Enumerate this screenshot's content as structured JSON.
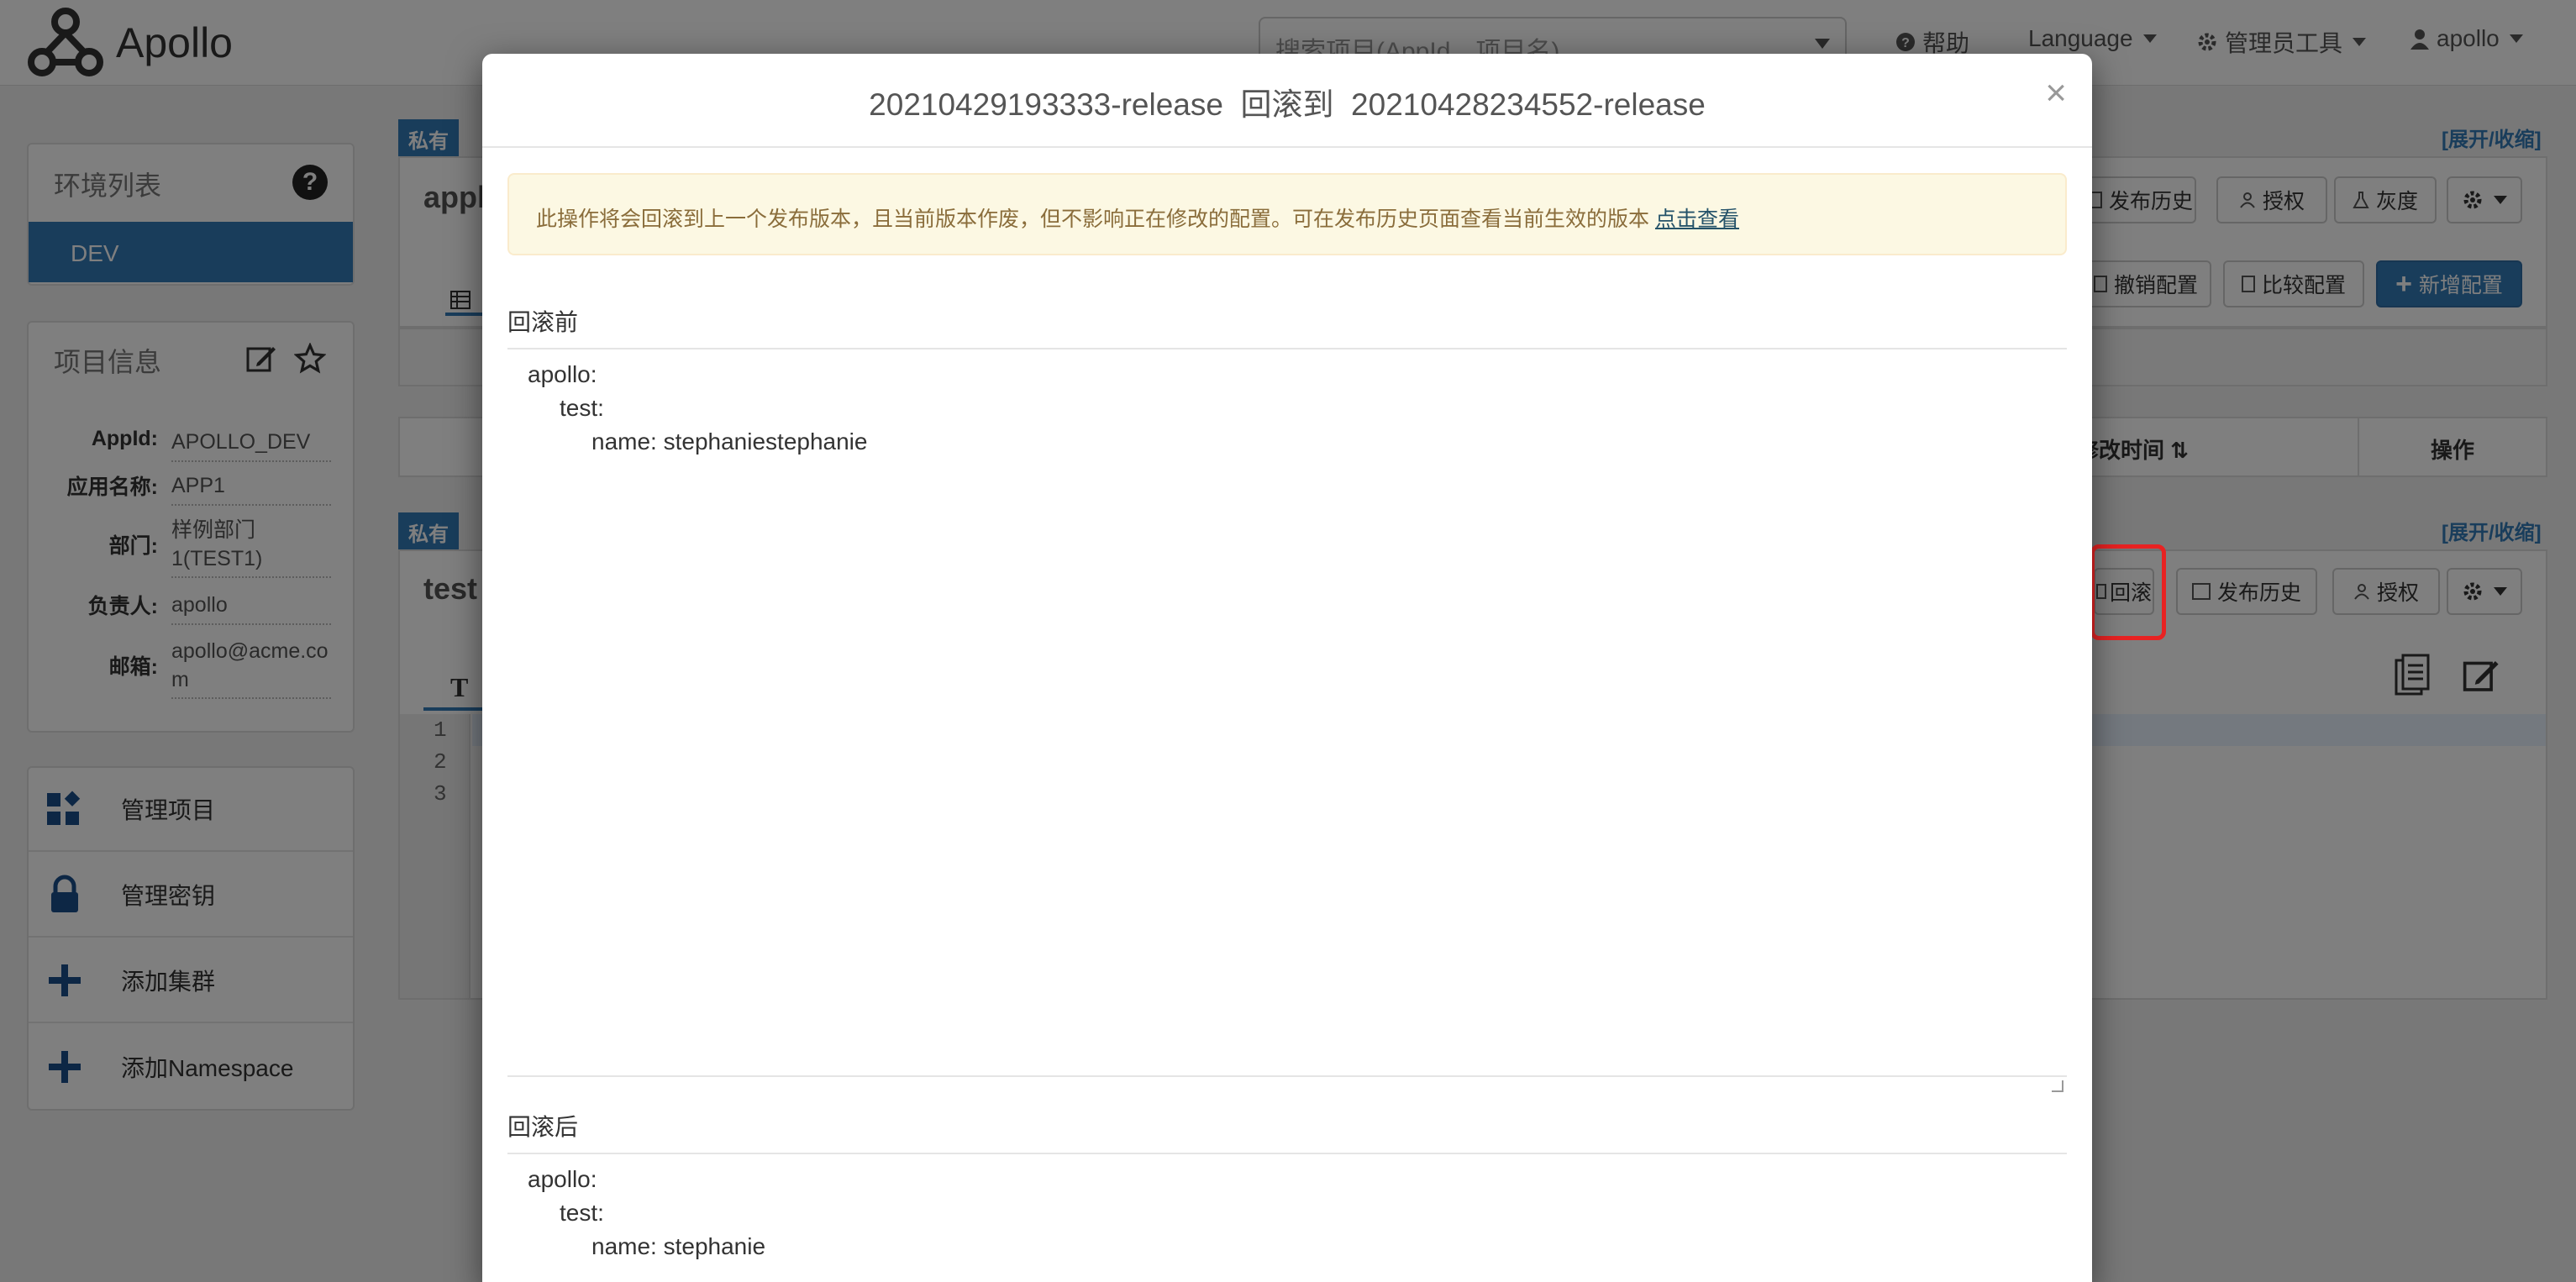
{
  "navbar": {
    "brand": "Apollo",
    "search_placeholder": "搜索项目(AppId、项目名)",
    "help": "帮助",
    "language": "Language",
    "admin_tools": "管理员工具",
    "user": "apollo"
  },
  "sidebar": {
    "env_title": "环境列表",
    "env_active": "DEV",
    "info_title": "项目信息",
    "info": [
      {
        "label": "AppId:",
        "value": "APOLLO_DEV"
      },
      {
        "label": "应用名称:",
        "value": "APP1"
      },
      {
        "label": "部门:",
        "value": "样例部门1(TEST1)"
      },
      {
        "label": "负责人:",
        "value": "apollo"
      },
      {
        "label": "邮箱:",
        "value": "apollo@acme.com"
      }
    ],
    "menu": [
      {
        "label": "管理项目",
        "icon": "grid-icon"
      },
      {
        "label": "管理密钥",
        "icon": "lock-icon"
      },
      {
        "label": "添加集群",
        "icon": "plus-icon"
      },
      {
        "label": "添加Namespace",
        "icon": "plus-icon"
      }
    ]
  },
  "main": {
    "ns1": {
      "tag": "私有",
      "name": "appl",
      "expand": "[展开/收缩]",
      "buttons": {
        "history": "发布历史",
        "auth": "授权",
        "gray": "灰度"
      },
      "actions": {
        "revoke": "撤销配置",
        "compare": "比较配置",
        "add": "新增配置"
      },
      "table_headers": {
        "modified_time": "修改时间",
        "op": "操作"
      }
    },
    "ns2": {
      "tag": "私有",
      "name": "test",
      "expand": "[展开/收缩]",
      "buttons": {
        "rollback": "回滚",
        "history": "发布历史",
        "auth": "授权"
      },
      "editor_tab": "T",
      "line_numbers": [
        "1",
        "2",
        "3"
      ]
    }
  },
  "modal": {
    "title": "20210429193333-release  回滚到  20210428234552-release",
    "close": "×",
    "alert_text": "此操作将会回滚到上一个发布版本，且当前版本作废，但不影响正在修改的配置。可在发布历史页面查看当前生效的版本",
    "alert_link": "点击查看",
    "before_label": "回滚前",
    "before_lines": [
      "apollo:",
      "test:",
      "name: stephaniestephanie"
    ],
    "after_label": "回滚后",
    "after_lines": [
      "apollo:",
      "test:",
      "name: stephanie"
    ]
  },
  "colors": {
    "primary": "#337ab7",
    "highlight": "#e82222",
    "alert_bg": "#fcf8e3"
  }
}
